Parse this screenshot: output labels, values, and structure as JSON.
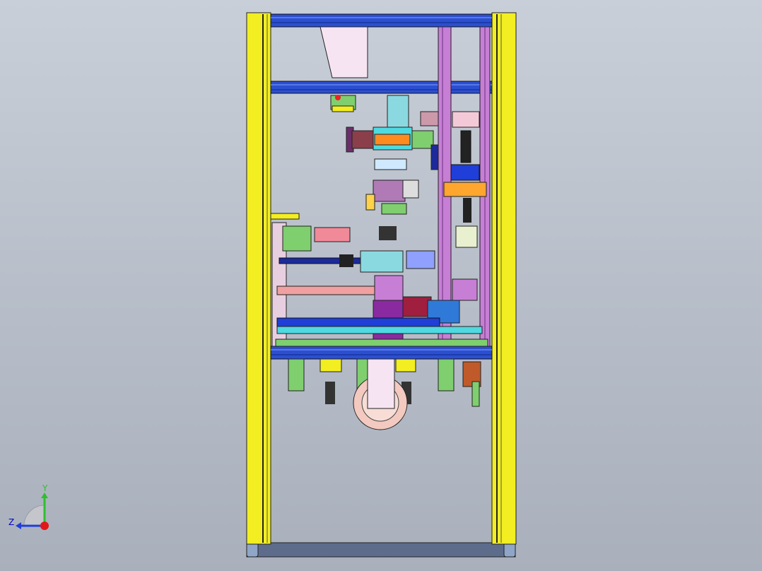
{
  "viewport": {
    "background_top": "#c9cfd8",
    "background_bottom": "#a9b0bc"
  },
  "model": {
    "description_colors": {
      "frame_post": "#f2ee21",
      "frame_beam": "#2c4fd0",
      "plate": "#c77fd6",
      "bottom_rail": "#5e6c8c"
    }
  },
  "triad": {
    "y_label": "Y",
    "z_label": "Z",
    "y_color": "#2fbf2f",
    "z_color": "#1f3fd8",
    "x_color": "#e01818"
  }
}
